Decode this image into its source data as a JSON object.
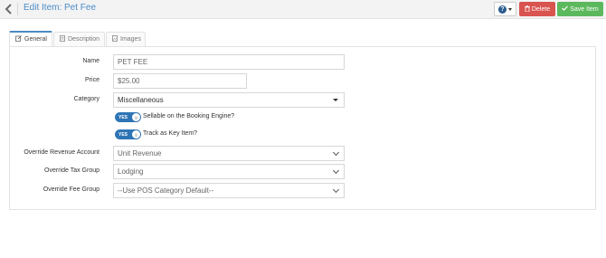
{
  "header": {
    "title": "Edit Item: Pet Fee",
    "help_icon_glyph": "?",
    "delete_label": "Delete",
    "save_label": "Save Item"
  },
  "tabs": [
    {
      "label": "General",
      "active": true
    },
    {
      "label": "Description",
      "active": false
    },
    {
      "label": "Images",
      "active": false
    }
  ],
  "form": {
    "name": {
      "label": "Name",
      "value": "PET FEE"
    },
    "price": {
      "label": "Price",
      "value": "$25.00"
    },
    "category": {
      "label": "Category",
      "value": "Miscellaneous"
    },
    "sellable": {
      "on_text": "YES",
      "label": "Sellable on the Booking Engine?",
      "enabled": true
    },
    "track_key": {
      "on_text": "YES",
      "label": "Track as Key Item?",
      "enabled": true
    },
    "override_revenue": {
      "label": "Override Revenue Account",
      "value": "Unit Revenue"
    },
    "override_tax": {
      "label": "Override Tax Group",
      "value": "Lodging"
    },
    "override_fee": {
      "label": "Override Fee Group",
      "value": "--Use POS Category Default--"
    }
  },
  "colors": {
    "accent": "#4a8cc4",
    "delete": "#d9534f",
    "save": "#5cb85c",
    "toggle": "#2f75b5"
  },
  "icons": [
    "back-chevron-icon",
    "help-icon",
    "trash-icon",
    "check-icon",
    "edit-icon",
    "document-icon",
    "image-icon",
    "chevron-down-icon"
  ]
}
